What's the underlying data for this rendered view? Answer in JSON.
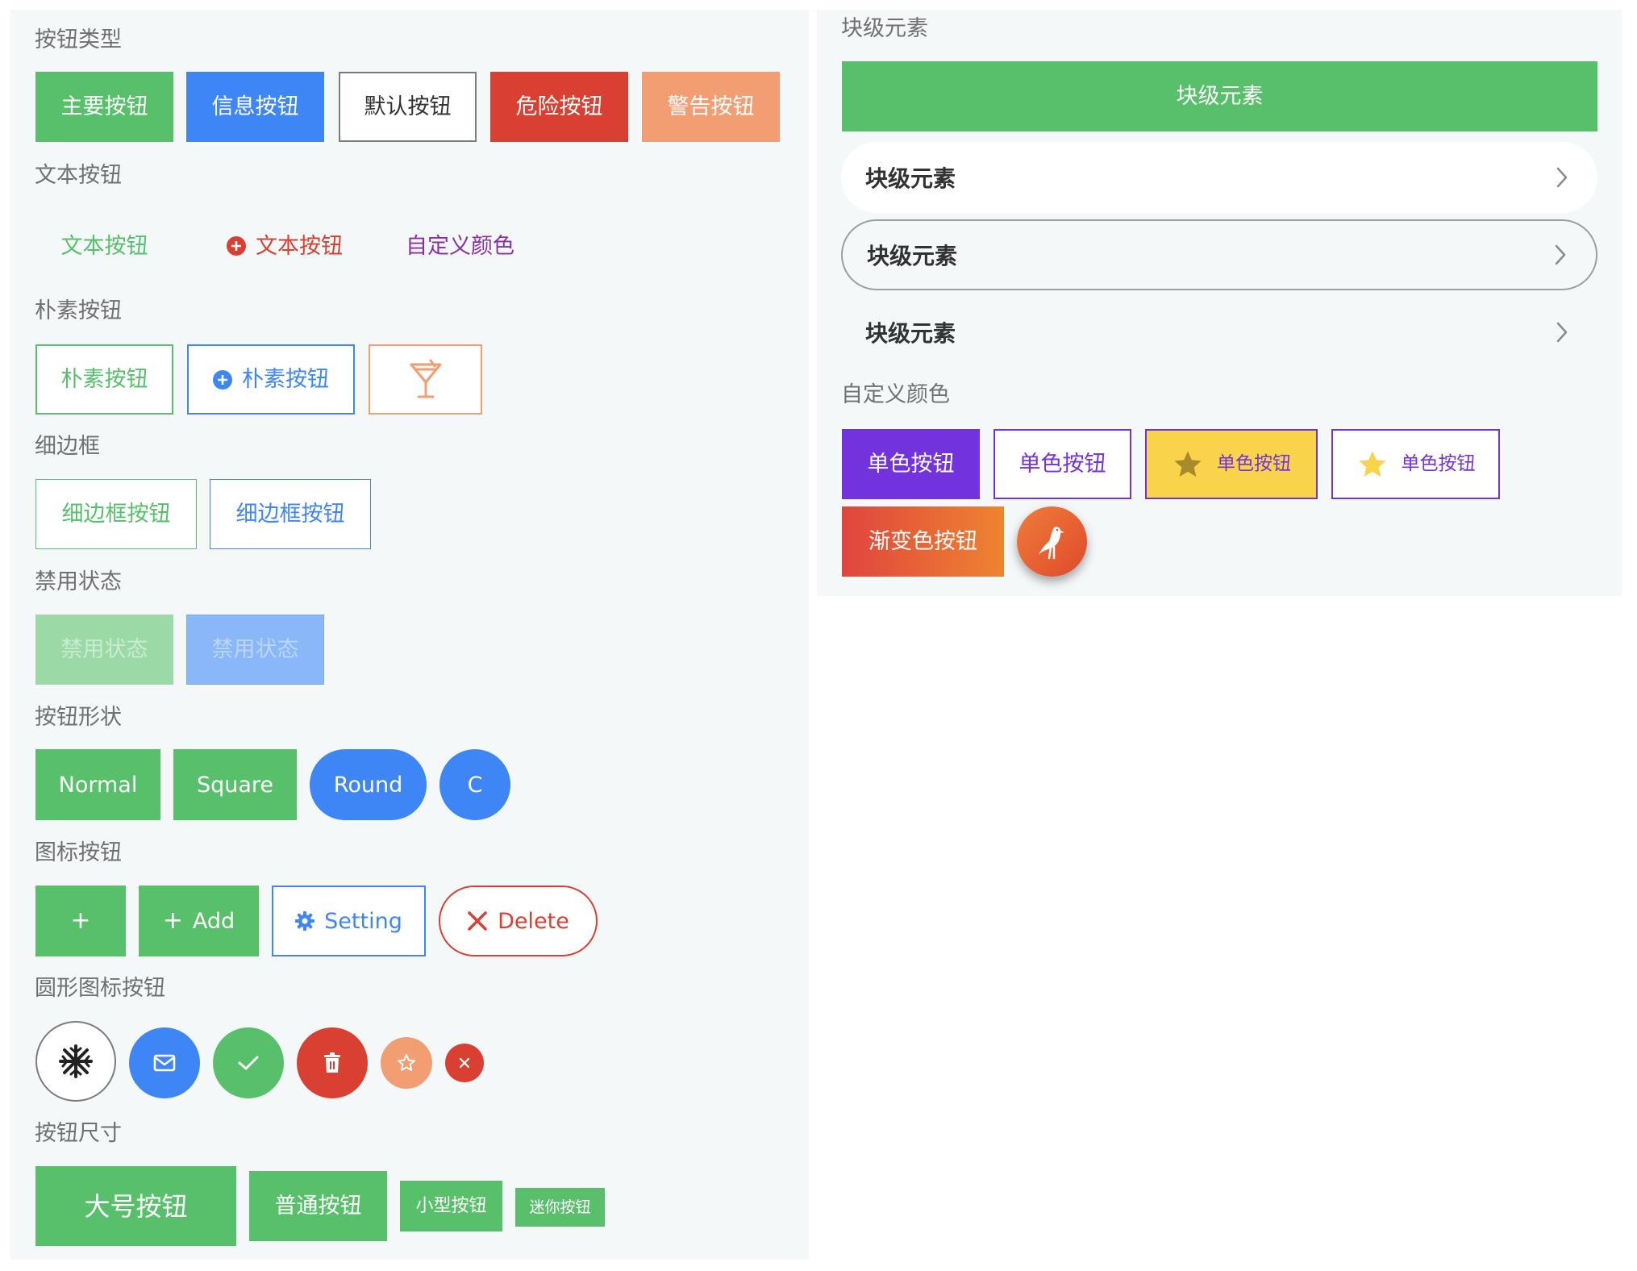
{
  "colors": {
    "primary": "#58c06a",
    "info": "#3e86f5",
    "danger": "#d94032",
    "warning": "#f29d72",
    "purple": "#7232dd",
    "yellow": "#f9d34a",
    "gradient_from": "#e0453d",
    "gradient_to": "#ee8430"
  },
  "left": {
    "sections": {
      "types": "按钮类型",
      "text": "文本按钮",
      "plain": "朴素按钮",
      "hairline": "细边框",
      "disabled": "禁用状态",
      "shape": "按钮形状",
      "icon": "图标按钮",
      "round_icon": "圆形图标按钮",
      "size": "按钮尺寸"
    },
    "types": {
      "primary": "主要按钮",
      "info": "信息按钮",
      "default": "默认按钮",
      "danger": "危险按钮",
      "warning": "警告按钮"
    },
    "text": {
      "green": "文本按钮",
      "red_with_icon": "文本按钮",
      "custom": "自定义颜色"
    },
    "plain": {
      "first": "朴素按钮",
      "second": "朴素按钮",
      "third_icon": "cocktail-icon"
    },
    "hairline": {
      "first": "细边框按钮",
      "second": "细边框按钮"
    },
    "disabled": {
      "first": "禁用状态",
      "second": "禁用状态"
    },
    "shape": {
      "normal": "Normal",
      "square": "Square",
      "round": "Round",
      "circle": "C"
    },
    "icon": {
      "plus": "+",
      "add": "Add",
      "setting": "Setting",
      "delete": "Delete"
    },
    "round_icon": {
      "icons": [
        "snowflake-icon",
        "mail-icon",
        "check-icon",
        "trash-icon",
        "star-icon",
        "close-icon"
      ]
    },
    "size": {
      "large": "大号按钮",
      "normal": "普通按钮",
      "small": "小型按钮",
      "mini": "迷你按钮"
    }
  },
  "right": {
    "sections": {
      "block": "块级元素",
      "custom": "自定义颜色"
    },
    "block": {
      "primary": "块级元素",
      "cell1": "块级元素",
      "cell2": "块级元素",
      "cell3": "块级元素"
    },
    "custom": {
      "solid": "单色按钮",
      "outline": "单色按钮",
      "star_yellow": "单色按钮",
      "star_outline": "单色按钮",
      "gradient": "渐变色按钮",
      "fab_icon": "seagull-icon"
    }
  }
}
